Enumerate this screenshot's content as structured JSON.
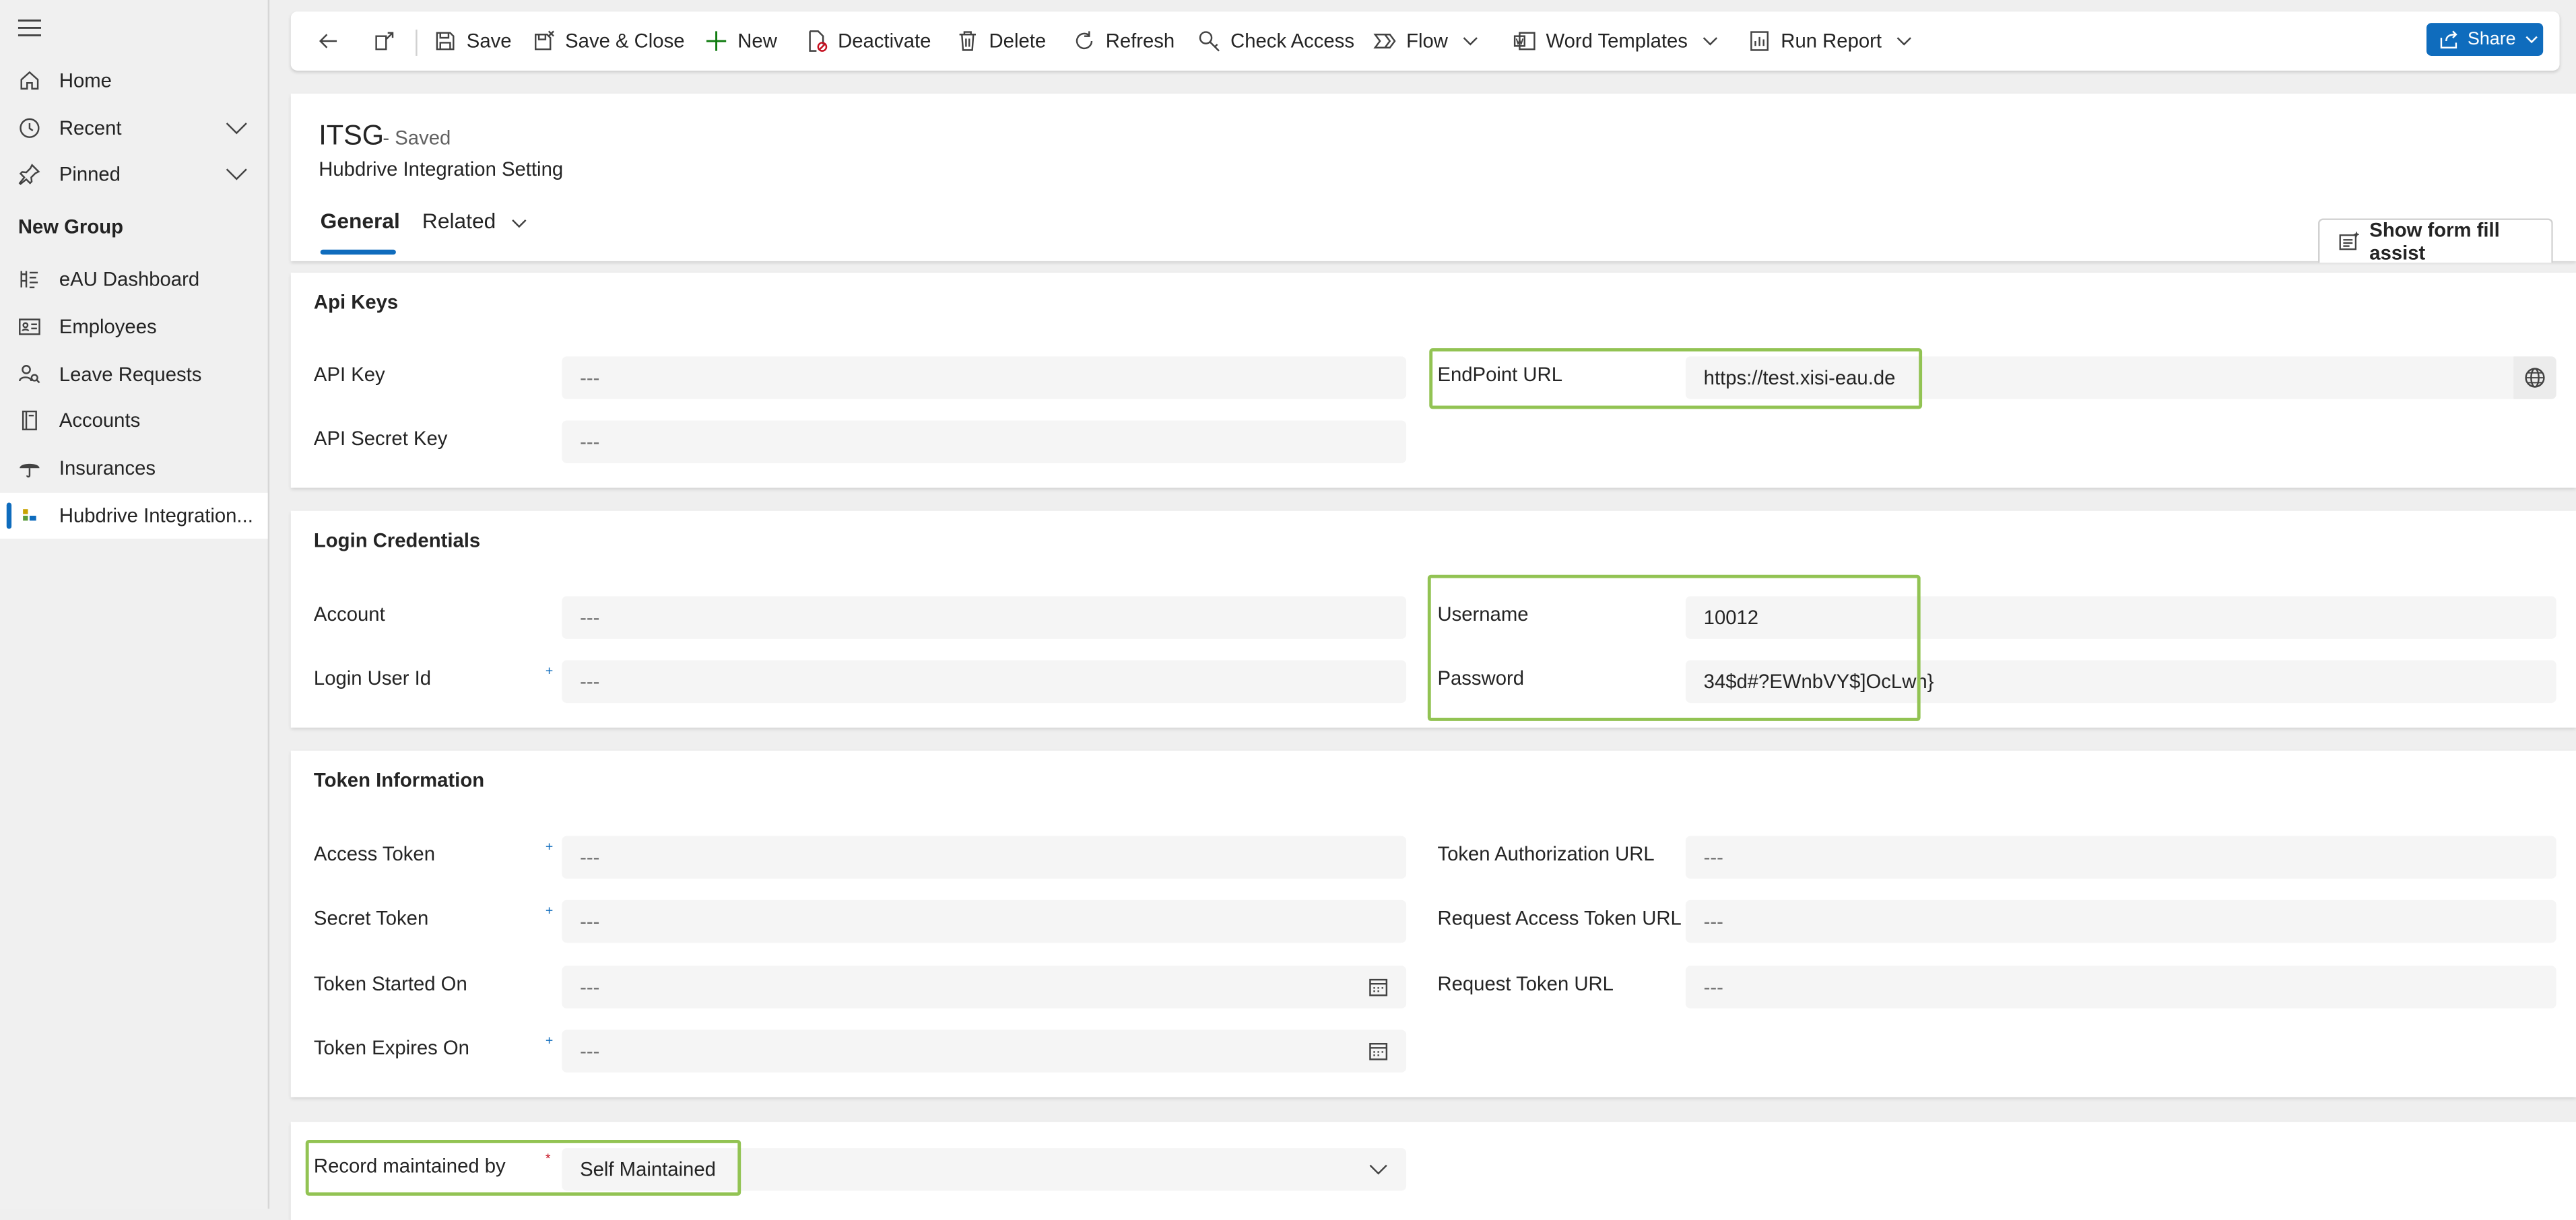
{
  "sidebar": {
    "items_top": [
      {
        "label": "Home",
        "icon": "home-icon"
      },
      {
        "label": "Recent",
        "icon": "clock-icon"
      },
      {
        "label": "Pinned",
        "icon": "pin-icon"
      }
    ],
    "group_title": "New Group",
    "items_group": [
      {
        "label": "eAU Dashboard",
        "icon": "dashboard-icon"
      },
      {
        "label": "Employees",
        "icon": "contact-card-icon"
      },
      {
        "label": "Leave Requests",
        "icon": "people-search-icon"
      },
      {
        "label": "Accounts",
        "icon": "book-icon"
      },
      {
        "label": "Insurances",
        "icon": "umbrella-icon"
      },
      {
        "label": "Hubdrive Integration...",
        "icon": "integration-icon",
        "active": true
      }
    ]
  },
  "commandbar": {
    "save": "Save",
    "save_close": "Save & Close",
    "new": "New",
    "deactivate": "Deactivate",
    "delete": "Delete",
    "refresh": "Refresh",
    "check_access": "Check Access",
    "flow": "Flow",
    "word_templates": "Word Templates",
    "run_report": "Run Report",
    "share": "Share"
  },
  "record": {
    "title": "ITSG",
    "status": "- Saved",
    "entity": "Hubdrive Integration Setting",
    "tabs": [
      "General",
      "Related"
    ],
    "form_fill_assist": "Show form fill assist"
  },
  "sections": {
    "api_keys": {
      "title": "Api Keys",
      "api_key": {
        "label": "API Key",
        "value": "---"
      },
      "api_secret_key": {
        "label": "API Secret Key",
        "value": "---"
      },
      "endpoint_url": {
        "label": "EndPoint URL",
        "value": "https://test.xisi-eau.de"
      }
    },
    "login": {
      "title": "Login Credentials",
      "account": {
        "label": "Account",
        "value": "---"
      },
      "login_user_id": {
        "label": "Login User Id",
        "value": "---"
      },
      "username": {
        "label": "Username",
        "value": "10012"
      },
      "password": {
        "label": "Password",
        "value": "34$d#?EWnbVY$]OcLwn}"
      }
    },
    "token": {
      "title": "Token Information",
      "access_token": {
        "label": "Access Token",
        "value": "---"
      },
      "secret_token": {
        "label": "Secret Token",
        "value": "---"
      },
      "token_started_on": {
        "label": "Token Started On",
        "value": "---"
      },
      "token_expires_on": {
        "label": "Token Expires On",
        "value": "---"
      },
      "token_authorization_url": {
        "label": "Token Authorization URL",
        "value": "---"
      },
      "request_access_token_url": {
        "label": "Request Access Token URL",
        "value": "---"
      },
      "request_token_url": {
        "label": "Request Token URL",
        "value": "---"
      }
    },
    "misc": {
      "record_maintained_by": {
        "label": "Record maintained by",
        "value": "Self Maintained"
      }
    }
  },
  "marks": {
    "required": "*",
    "recommended": "+"
  },
  "colors": {
    "accent": "#0f6cbd",
    "highlight": "#92c353",
    "required": "#c50f1f"
  }
}
